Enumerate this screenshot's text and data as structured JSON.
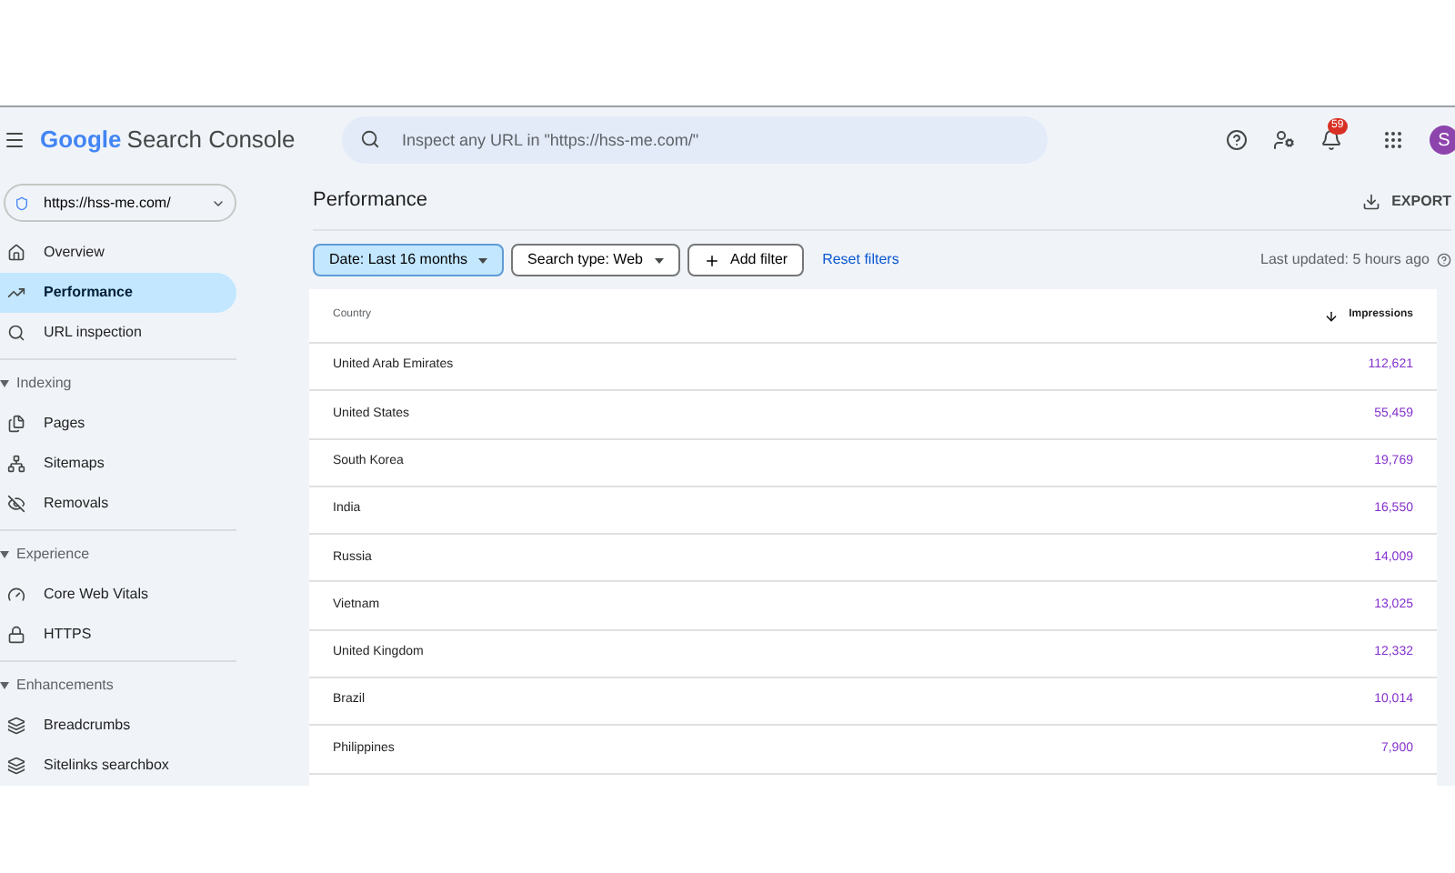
{
  "header": {
    "product": {
      "brand": "Google",
      "name": "Search Console"
    },
    "search": {
      "placeholder": "Inspect any URL in \"https://hss-me.com/\""
    },
    "notifications": {
      "badge": "59"
    },
    "avatar": "S"
  },
  "property": {
    "value": "https://hss-me.com/"
  },
  "sidebar": {
    "items": [
      {
        "label": "Overview",
        "kind": "home",
        "selected": false
      },
      {
        "label": "Performance",
        "kind": "trend",
        "selected": true
      },
      {
        "label": "URL inspection",
        "kind": "search",
        "selected": false
      }
    ],
    "sections": [
      {
        "label": "Indexing",
        "expanded": true,
        "items": [
          {
            "label": "Pages",
            "kind": "pages",
            "selected": false
          },
          {
            "label": "Sitemaps",
            "kind": "sitemap",
            "selected": false
          },
          {
            "label": "Removals",
            "kind": "eye-off",
            "selected": false
          }
        ]
      },
      {
        "label": "Experience",
        "expanded": true,
        "items": [
          {
            "label": "Core Web Vitals",
            "kind": "gauge",
            "selected": false
          },
          {
            "label": "HTTPS",
            "kind": "lock",
            "selected": false
          }
        ]
      },
      {
        "label": "Enhancements",
        "expanded": true,
        "items": [
          {
            "label": "Breadcrumbs",
            "kind": "layers",
            "selected": false
          },
          {
            "label": "Sitelinks searchbox",
            "kind": "layers",
            "selected": false
          }
        ]
      }
    ]
  },
  "page": {
    "title": "Performance",
    "export": "EXPORT"
  },
  "filters": {
    "chips": [
      {
        "label": "Date: Last 16 months",
        "kind": "dropdown",
        "selected": true
      },
      {
        "label": "Search type: Web",
        "kind": "dropdown",
        "selected": false
      },
      {
        "label": "Add filter",
        "kind": "add",
        "selected": false
      }
    ],
    "reset": "Reset filters",
    "last_updated": "Last updated: 5 hours ago"
  },
  "table": {
    "columns": [
      "Country",
      "Impressions"
    ],
    "rows": [
      [
        "United Arab Emirates",
        "112,621"
      ],
      [
        "United States",
        "55,459"
      ],
      [
        "South Korea",
        "19,769"
      ],
      [
        "India",
        "16,550"
      ],
      [
        "Russia",
        "14,009"
      ],
      [
        "Vietnam",
        "13,025"
      ],
      [
        "United Kingdom",
        "12,332"
      ],
      [
        "Brazil",
        "10,014"
      ],
      [
        "Philippines",
        "7,900"
      ]
    ]
  }
}
